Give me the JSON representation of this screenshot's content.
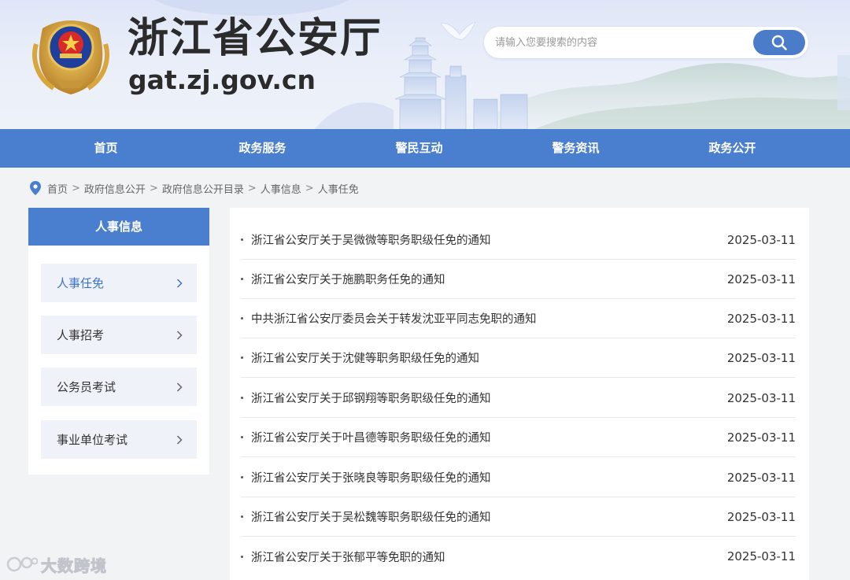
{
  "header": {
    "site_title": "浙江省公安厅",
    "site_domain": "gat.zj.gov.cn",
    "search_placeholder": "请输入您要搜索的内容"
  },
  "nav": {
    "items": [
      "首页",
      "政务服务",
      "警民互动",
      "警务资讯",
      "政务公开"
    ]
  },
  "breadcrumb": [
    "首页",
    "政府信息公开",
    "政府信息公开目录",
    "人事信息",
    "人事任免"
  ],
  "sidebar": {
    "title": "人事信息",
    "items": [
      {
        "label": "人事任免",
        "active": true
      },
      {
        "label": "人事招考",
        "active": false
      },
      {
        "label": "公务员考试",
        "active": false
      },
      {
        "label": "事业单位考试",
        "active": false
      }
    ]
  },
  "list": [
    {
      "title": "浙江省公安厅关于吴微微等职务职级任免的通知",
      "date": "2025-03-11"
    },
    {
      "title": "浙江省公安厅关于施鹏职务任免的通知",
      "date": "2025-03-11"
    },
    {
      "title": "中共浙江省公安厅委员会关于转发沈亚平同志免职的通知",
      "date": "2025-03-11"
    },
    {
      "title": "浙江省公安厅关于沈健等职务职级任免的通知",
      "date": "2025-03-11"
    },
    {
      "title": "浙江省公安厅关于邱钢翔等职务职级任免的通知",
      "date": "2025-03-11"
    },
    {
      "title": "浙江省公安厅关于叶昌德等职务职级任免的通知",
      "date": "2025-03-11"
    },
    {
      "title": "浙江省公安厅关于张晓良等职务职级任免的通知",
      "date": "2025-03-11"
    },
    {
      "title": "浙江省公安厅关于吴松魏等职务职级任免的通知",
      "date": "2025-03-11"
    },
    {
      "title": "浙江省公安厅关于张郁平等免职的通知",
      "date": "2025-03-11"
    }
  ],
  "watermark": {
    "text": "大数跨境"
  },
  "colors": {
    "primary": "#4a7ecf",
    "active_text": "#3b73c7",
    "page_bg": "#f2f3f5"
  }
}
